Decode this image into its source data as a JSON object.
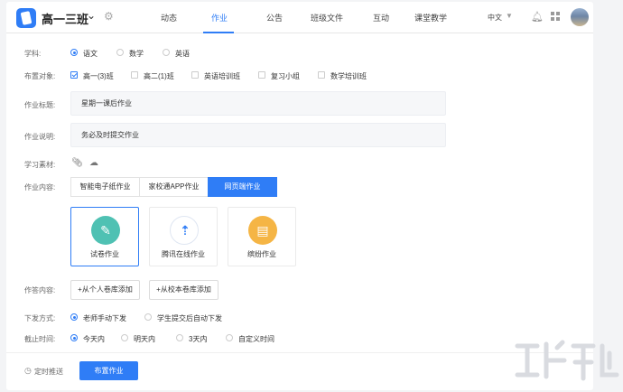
{
  "header": {
    "class_name": "高一三班",
    "nav": [
      "动态",
      "作业",
      "公告",
      "班级文件",
      "互动",
      "课堂教学"
    ],
    "active_nav": "作业",
    "language": "中文"
  },
  "form": {
    "subject": {
      "label": "学科:",
      "options": [
        "语文",
        "数学",
        "英语"
      ],
      "selected": "语文"
    },
    "target": {
      "label": "布置对象:",
      "options": [
        "高一(3)班",
        "高二(1)班",
        "英语培训班",
        "复习小组",
        "数学培训班"
      ],
      "checked": [
        "高一(3)班"
      ]
    },
    "title": {
      "label": "作业标题:",
      "value": "星期一课后作业"
    },
    "desc": {
      "label": "作业说明:",
      "value": "务必及时提交作业"
    },
    "materials": {
      "label": "学习素材:"
    },
    "content": {
      "label": "作业内容:",
      "tabs": [
        "智能电子纸作业",
        "家校通APP作业",
        "网页端作业"
      ],
      "active_tab": "网页端作业",
      "types": [
        {
          "label": "试卷作业",
          "icon": "exam-paper-icon",
          "color": "#4fc1b3",
          "active": true
        },
        {
          "label": "腾讯在线作业",
          "icon": "tencent-online-icon",
          "color": "#ffffff",
          "active": false
        },
        {
          "label": "缤纷作业",
          "icon": "colorful-homework-icon",
          "color": "#f5b545",
          "active": false
        }
      ]
    },
    "answer": {
      "label": "作答内容:",
      "buttons": [
        "+从个人卷库添加",
        "+从校本卷库添加"
      ]
    },
    "dispatch": {
      "label": "下发方式:",
      "options": [
        "老师手动下发",
        "学生提交后自动下发"
      ],
      "selected": "老师手动下发"
    },
    "deadline": {
      "label": "截止时间:",
      "options": [
        "今天内",
        "明天内",
        "3天内",
        "自定义时间"
      ],
      "selected": "今天内"
    }
  },
  "footer": {
    "timer_label": "定时推送",
    "submit_label": "布置作业"
  },
  "colors": {
    "accent": "#2f7df6"
  }
}
